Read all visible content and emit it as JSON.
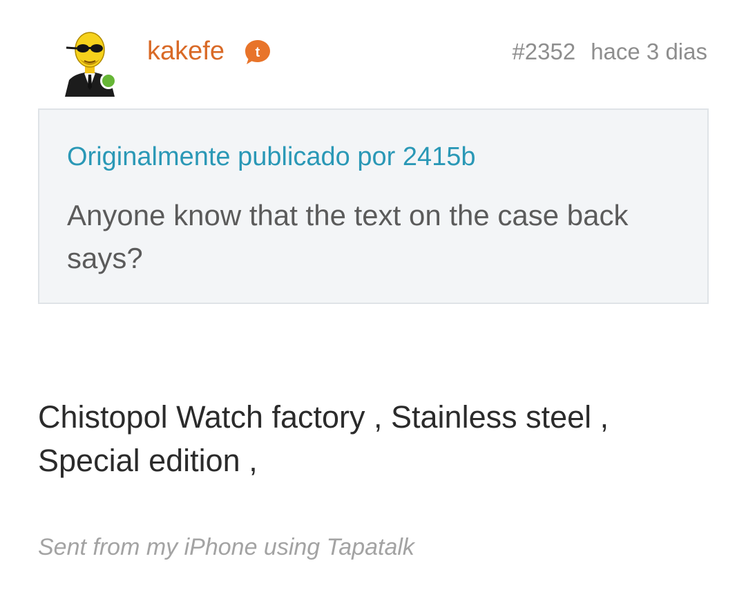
{
  "post": {
    "author": {
      "username": "kakefe",
      "avatar_icon": "bald-character-sunglasses-avatar",
      "online_status_color": "#66b636",
      "badge_icon": "tapatalk-icon"
    },
    "number": "#2352",
    "timestamp": "hace 3 dias",
    "quote": {
      "author_line": "Originalmente publicado por 2415b",
      "text": "Anyone know that the text on the case back says?"
    },
    "body": "Chistopol Watch factory , Stainless steel , Special edition ,",
    "signature": "Sent from my iPhone using Tapatalk"
  },
  "colors": {
    "username": "#d96a27",
    "quote_link": "#2a98b6",
    "quote_background": "#f3f5f7",
    "meta_text": "#8e8e8e"
  }
}
